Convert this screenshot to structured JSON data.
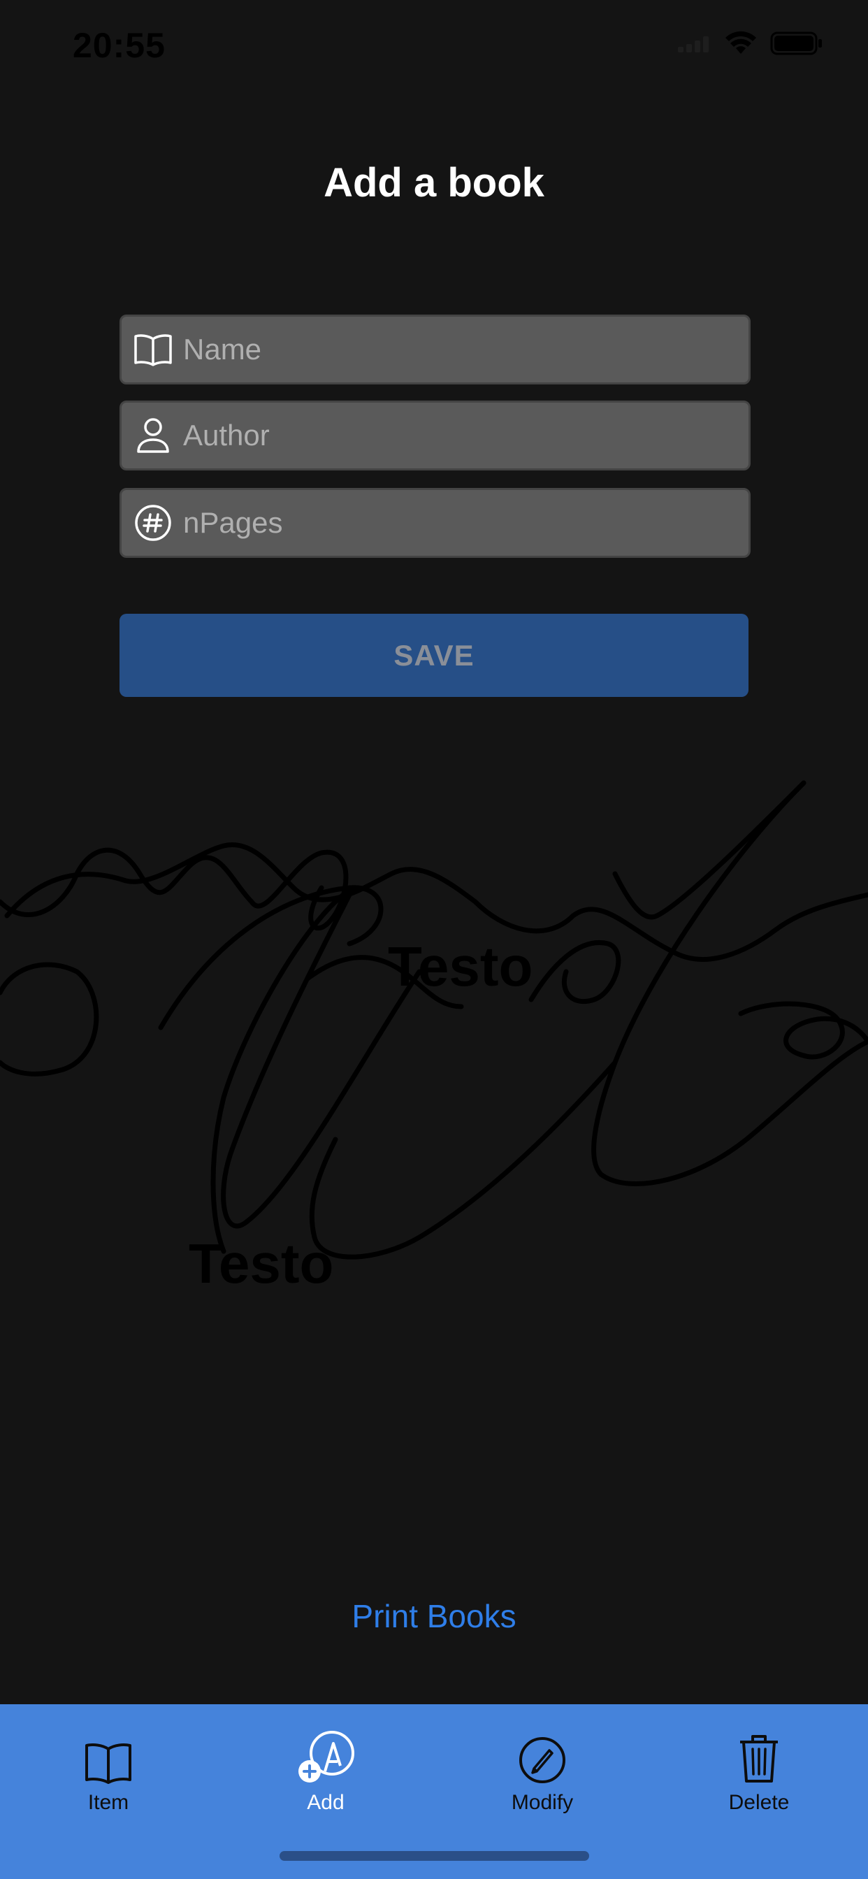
{
  "status_bar": {
    "time": "20:55"
  },
  "header": {
    "title": "Add a book"
  },
  "form": {
    "name_placeholder": "Name",
    "author_placeholder": "Author",
    "pages_placeholder": "nPages",
    "save_label": "SAVE"
  },
  "signature_area": {
    "text_1": "Testo",
    "text_2": "Testo"
  },
  "links": {
    "print_books": "Print Books"
  },
  "tab_bar": {
    "items": [
      {
        "label": "Item",
        "icon": "book-icon"
      },
      {
        "label": "Add",
        "icon": "add-pencil-icon"
      },
      {
        "label": "Modify",
        "icon": "pencil-circle-icon"
      },
      {
        "label": "Delete",
        "icon": "trash-icon"
      }
    ],
    "active_index": 1
  },
  "colors": {
    "background": "#141414",
    "field": "#5a5a5a",
    "save_button": "#264f87",
    "link": "#2f7ee8",
    "tab_bar": "#4583db"
  }
}
